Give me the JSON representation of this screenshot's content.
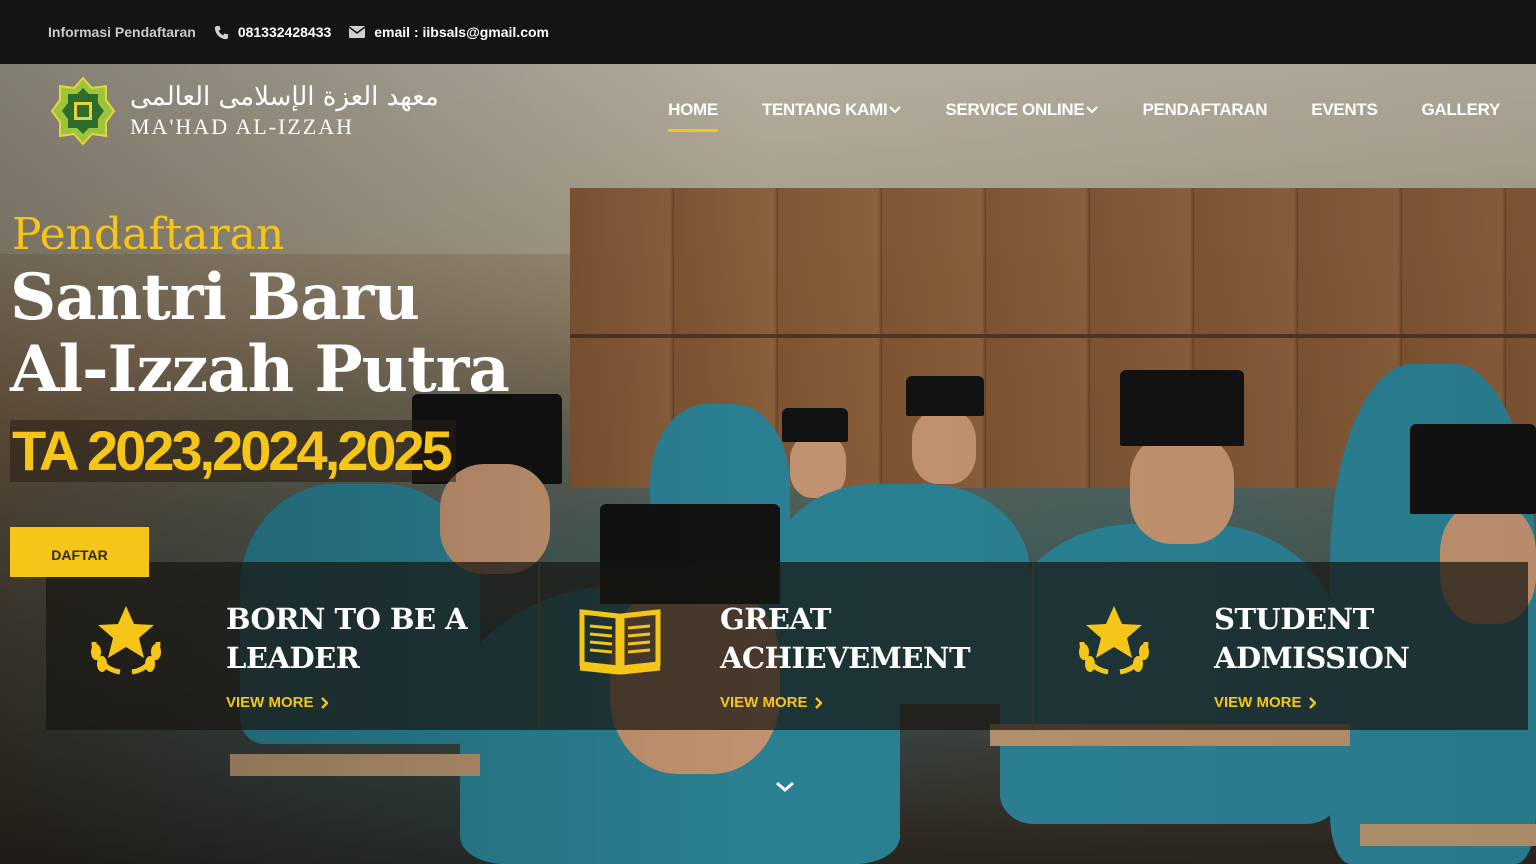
{
  "topbar": {
    "info_label": "Informasi Pendaftaran",
    "phone": "081332428433",
    "email": "email : iibsals@gmail.com"
  },
  "logo": {
    "arabic": "معهد العزة الإسلامى العالمى",
    "latin": "MA'HAD AL-IZZAH"
  },
  "nav": {
    "items": [
      {
        "label": "HOME",
        "active": true,
        "dropdown": false
      },
      {
        "label": "TENTANG KAMI",
        "active": false,
        "dropdown": true
      },
      {
        "label": "SERVICE ONLINE",
        "active": false,
        "dropdown": true
      },
      {
        "label": "PENDAFTARAN",
        "active": false,
        "dropdown": false
      },
      {
        "label": "EVENTS",
        "active": false,
        "dropdown": false
      },
      {
        "label": "GALLERY",
        "active": false,
        "dropdown": false
      }
    ]
  },
  "hero": {
    "pre_title": "Pendaftaran",
    "title_line1": "Santri Baru",
    "title_line2": "Al-Izzah Putra",
    "year": "TA 2023,2024,2025",
    "cta": "DAFTAR"
  },
  "features": [
    {
      "line1": "BORN TO BE A",
      "line2": "LEADER",
      "more": "VIEW MORE",
      "icon": "star-laurel-icon"
    },
    {
      "line1": "GREAT",
      "line2": "ACHIEVEMENT",
      "more": "VIEW MORE",
      "icon": "open-book-icon"
    },
    {
      "line1": "STUDENT",
      "line2": "ADMISSION",
      "more": "VIEW MORE",
      "icon": "star-laurel-icon"
    }
  ],
  "colors": {
    "accent": "#f5c518",
    "topbar": "#141414"
  }
}
